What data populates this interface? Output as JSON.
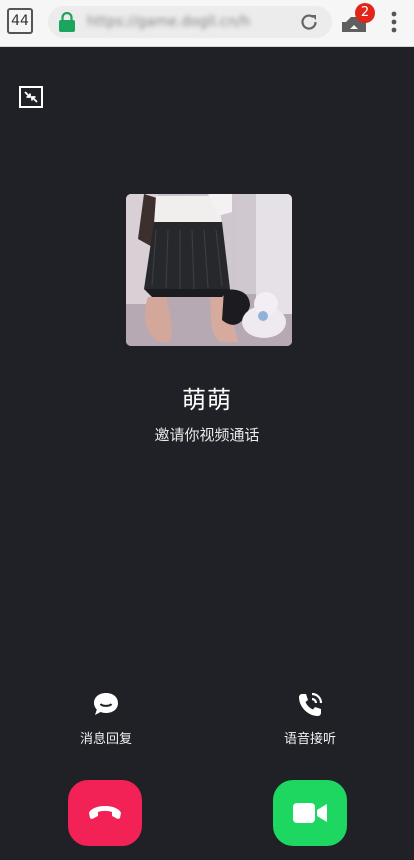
{
  "browser": {
    "tab_count": "44",
    "url": "https://game.dogll.cn/h",
    "download_badge": "2",
    "icons": [
      "lock-icon",
      "reload-icon",
      "download-icon",
      "menu-icon"
    ],
    "colors": {
      "lock": "#1da45e",
      "badge": "#e1251b"
    }
  },
  "call": {
    "caller_name": "萌萌",
    "subtitle": "邀请你视频通话",
    "minimize_icon": "minimize-icon",
    "message_reply_label": "消息回复",
    "voice_answer_label": "语音接听",
    "colors": {
      "background": "#1f2127",
      "decline": "#f22156",
      "accept": "#1ed760"
    }
  }
}
